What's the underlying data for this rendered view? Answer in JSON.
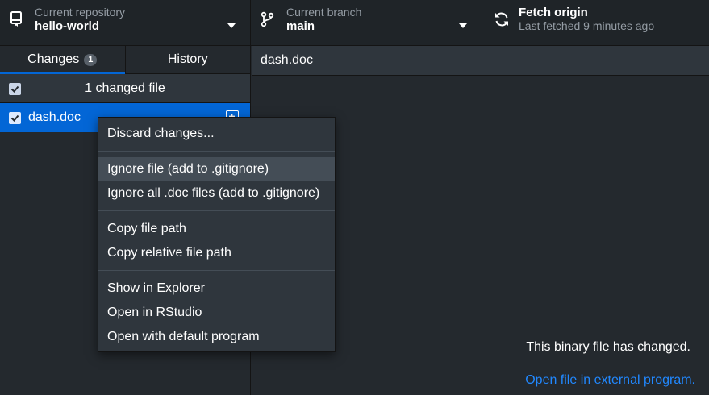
{
  "toolbar": {
    "repository": {
      "label": "Current repository",
      "value": "hello-world",
      "icon": "repo-icon"
    },
    "branch": {
      "label": "Current branch",
      "value": "main",
      "icon": "branch-icon"
    },
    "fetch": {
      "title": "Fetch origin",
      "subtitle": "Last fetched 9 minutes ago",
      "icon": "sync-icon"
    }
  },
  "sidebar": {
    "tabs": [
      {
        "label": "Changes",
        "badge": "1",
        "selected": true
      },
      {
        "label": "History",
        "selected": false
      }
    ],
    "changes_header": "1 changed file",
    "files": [
      {
        "name": "dash.doc",
        "checked": true,
        "status": "added",
        "selected": true
      }
    ]
  },
  "main": {
    "file_header": "dash.doc",
    "binary_message": "This binary file has changed.",
    "open_external_link": "Open file in external program."
  },
  "context_menu": {
    "groups": [
      [
        "Discard changes..."
      ],
      [
        "Ignore file (add to .gitignore)",
        "Ignore all .doc files (add to .gitignore)"
      ],
      [
        "Copy file path",
        "Copy relative file path"
      ],
      [
        "Show in Explorer",
        "Open in RStudio",
        "Open with default program"
      ]
    ],
    "hovered_item": "Ignore file (add to .gitignore)"
  },
  "colors": {
    "accent": "#0366d6",
    "link": "#2188ff",
    "background": "#24292e",
    "toolbar_bg": "#1f2428"
  }
}
